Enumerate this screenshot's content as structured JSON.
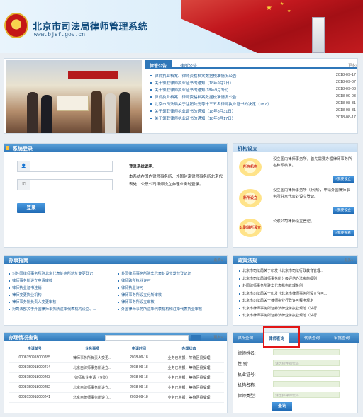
{
  "header": {
    "title": "北京市司法局律师管理系统",
    "url": "www.bjsf.gov.cn"
  },
  "notice_tabs": {
    "active": "律管公告",
    "other": "律所公告",
    "more": "更多»"
  },
  "notices": [
    {
      "title": "律师执业档案、律师资格档案数据校准情况公告",
      "date": "2018-09-17"
    },
    {
      "title": "关于领取律师执业证书的通知（18年9月7日）",
      "date": "2018-09-07"
    },
    {
      "title": "关于领取律师执业证书的通知(18年9月3日)",
      "date": "2018-09-03"
    },
    {
      "title": "律师执业档案、律师资格档案数据校准情况公告",
      "date": "2018-09-03"
    },
    {
      "title": "北京市司法局关于注销陆光等十三五名律师执业证书的决定（18.8）",
      "date": "2018-08-31"
    },
    {
      "title": "关于领取律师执业证书的通知（18年8月31日）",
      "date": "2018-08-31"
    },
    {
      "title": "关于领取律师执业证书的通知（18年8月17日）",
      "date": "2018-08-17"
    }
  ],
  "login": {
    "title": "系统登录",
    "button": "登录",
    "help_title": "登录系统说明:",
    "help_text": "本系统在国内律师事务所、外国驻京律师事务所北京代表处、公职公司律师设立办理业务时登录。"
  },
  "org": {
    "title": "机构设立",
    "items": [
      {
        "icon": "所在机构",
        "text": "设立国内律师事务所，首先需要办理律师事务所名称预核准。",
        "button": "»我要设立"
      },
      {
        "icon": "新所设立",
        "text": "设立国内律师事务所（分所），申请外国律师事务所驻京代表处设立登记。",
        "button": "»我要设立"
      },
      {
        "icon": "公职律所设立",
        "text": "公职公司律师设立登记。",
        "button": "»我要查看"
      }
    ]
  },
  "guide": {
    "title": "办事指南",
    "more": "更多»",
    "left": [
      "对外国律师事务所驻北京代表处住所地址变更登记",
      "律师事务所设立申请审核",
      "律师执业证书注销",
      "律师变更执业机构",
      "律师事务所负责人变更审核",
      "对司法部关于外国律师事务所驻华代表机构设立、..."
    ],
    "right": [
      "外国律师事务所驻华代表处设立发放登记证",
      "律师跨所执业许可",
      "律师执业许可",
      "律师事务所设立分所审核",
      "律师事务所设立审核",
      "外国律师事务所驻华代表机构和驻华代表执业审核"
    ]
  },
  "news": {
    "title": "政策法规",
    "more": "更多»",
    "items": [
      "北京市司法局关于印发《北京市司法行政教育管理...",
      "北京市司法局律师事务所分级评估办法实施细则",
      "外国律师事务所驻华代表机构管理条例",
      "北京市司法局关于印发《北京市律师事务所设立许可...",
      "北京市司法局关于律师执业行政许可程序规定",
      "北京市律师事务所证券法律业务执业规范（试行...",
      "北京市律师事务所证券法律业务执业规范（试行..."
    ]
  },
  "progress": {
    "title": "办理情况查询",
    "more": "更多»",
    "columns": [
      "申请单号",
      "业务事项",
      "申请时间",
      "办理状态"
    ],
    "rows": [
      [
        "0008150918000285",
        "律师事务所负责人变更...",
        "2018-09-18",
        "业务已申报，等待区县受理"
      ],
      [
        "0008150918000274",
        "北京自律师事务所设立...",
        "2018-09-18",
        "业务已申报，等待区县受理"
      ],
      [
        "0008150918000263",
        "律师执业申请（专职）",
        "2018-09-18",
        "业务已申报，等待区县受理"
      ],
      [
        "0008150918000252",
        "北京自律师事务所设立...",
        "2018-09-18",
        "业务已申报，等待区县受理"
      ],
      [
        "0008150918000241",
        "北京自律师事务所设立...",
        "2018-09-18",
        "业务已申报，等待区县受理"
      ]
    ]
  },
  "query": {
    "tabs": [
      "律所查询",
      "律师查询",
      "代表查询",
      "审批查询"
    ],
    "active_tab": "律师查询",
    "fields": [
      {
        "label": "律师姓名:",
        "placeholder": ""
      },
      {
        "label": "性    别:",
        "placeholder": "请选择性别代码"
      },
      {
        "label": "执业证号:",
        "placeholder": ""
      },
      {
        "label": "机构名称:",
        "placeholder": ""
      },
      {
        "label": "律师类型:",
        "placeholder": "请选择律师代码"
      }
    ],
    "button": "查询"
  },
  "colors": {
    "primary": "#2f77b9",
    "highlight": "#e21616",
    "flag": "#c2181e"
  }
}
